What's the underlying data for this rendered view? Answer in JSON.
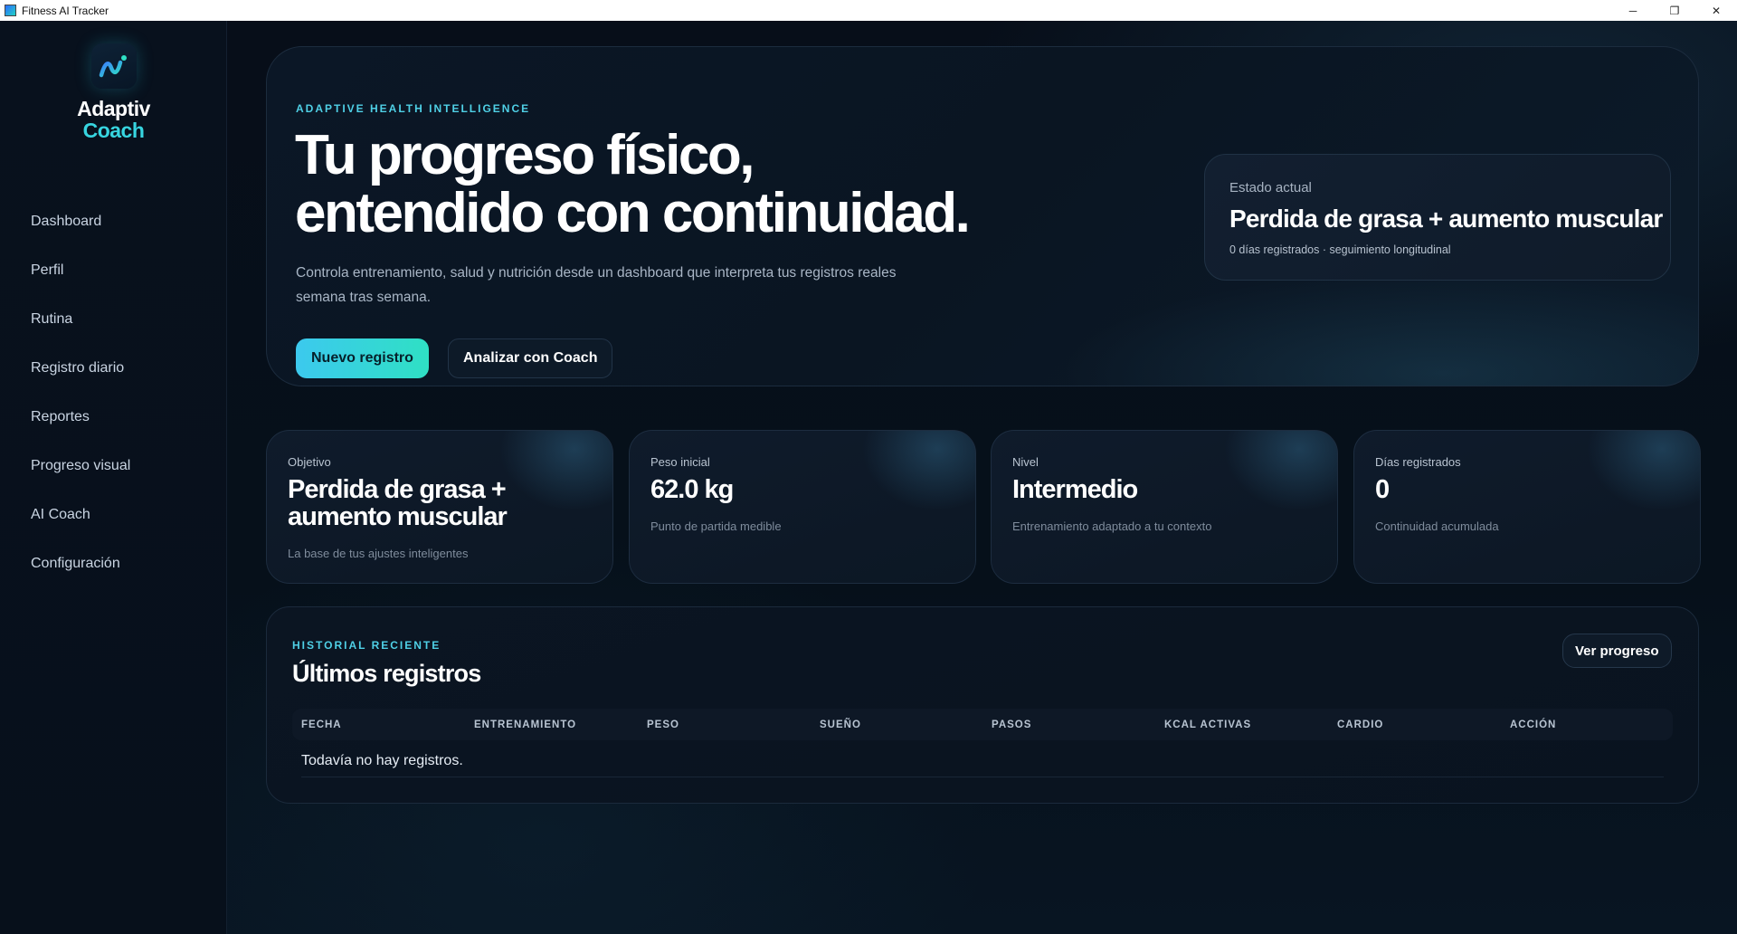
{
  "window": {
    "title": "Fitness AI Tracker",
    "controls": {
      "minimize": "─",
      "restore": "❐",
      "close": "✕"
    }
  },
  "brand": {
    "line1": "Adaptiv",
    "line2": "Coach",
    "logo_icon": "wave-logo-icon",
    "accent_color": "#37d5e0"
  },
  "nav": {
    "items": [
      {
        "label": "Dashboard"
      },
      {
        "label": "Perfil"
      },
      {
        "label": "Rutina"
      },
      {
        "label": "Registro diario"
      },
      {
        "label": "Reportes"
      },
      {
        "label": "Progreso visual"
      },
      {
        "label": "AI Coach"
      },
      {
        "label": "Configuración"
      }
    ]
  },
  "hero": {
    "eyebrow": "ADAPTIVE HEALTH INTELLIGENCE",
    "title_line1": "Tu progreso físico,",
    "title_line2": "entendido con continuidad.",
    "description": "Controla entrenamiento, salud y nutrición desde un dashboard que interpreta tus registros reales semana tras semana.",
    "primary_button": "Nuevo registro",
    "secondary_button": "Analizar con Coach",
    "status": {
      "label": "Estado actual",
      "value": "Perdida de grasa + aumento muscular",
      "sub": "0 días registrados · seguimiento longitudinal"
    }
  },
  "metrics": [
    {
      "label": "Objetivo",
      "value": "Perdida de grasa + aumento muscular",
      "sub": "La base de tus ajustes inteligentes"
    },
    {
      "label": "Peso inicial",
      "value": "62.0 kg",
      "sub": "Punto de partida medible"
    },
    {
      "label": "Nivel",
      "value": "Intermedio",
      "sub": "Entrenamiento adaptado a tu contexto"
    },
    {
      "label": "Días registrados",
      "value": "0",
      "sub": "Continuidad acumulada"
    }
  ],
  "records": {
    "eyebrow": "HISTORIAL RECIENTE",
    "title": "Últimos registros",
    "button": "Ver progreso",
    "columns": [
      "FECHA",
      "ENTRENAMIENTO",
      "PESO",
      "SUEÑO",
      "PASOS",
      "KCAL ACTIVAS",
      "CARDIO",
      "ACCIÓN"
    ],
    "empty_message": "Todavía no hay registros."
  },
  "colors": {
    "primary_gradient_start": "#3cc9ee",
    "primary_gradient_end": "#2fe0c4",
    "eyebrow": "#4fd0e6",
    "background": "#060c16"
  }
}
